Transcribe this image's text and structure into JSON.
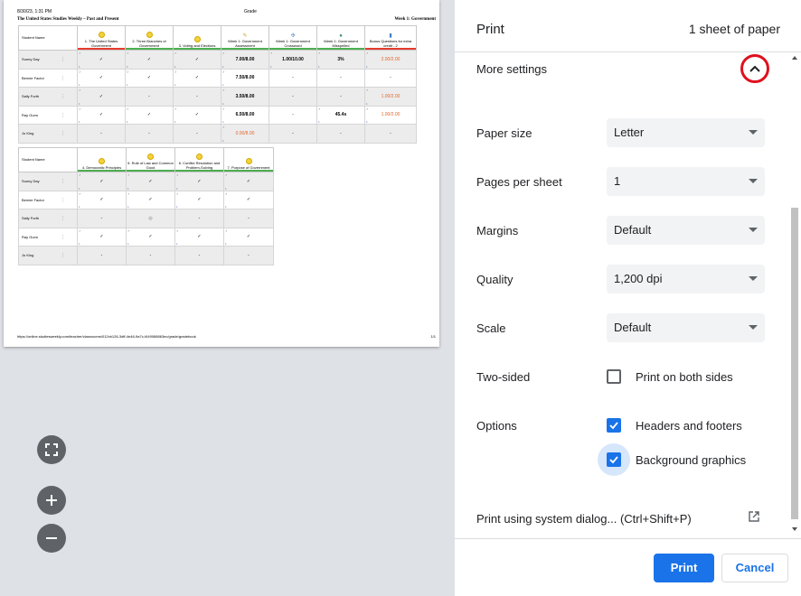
{
  "preview": {
    "header_datetime": "8/30/23, 1:31 PM",
    "header_title": "Grade",
    "course_title": "The United States Studies Weekly – Past and Present",
    "week_title": "Week 1: Government",
    "footer_url": "https://online.studiesweekly.com/teacher/classrooms/012cb126-3dff-4e46-9a7c-f449068863ec/grade/gradebook",
    "footer_page": "1/1",
    "table1": {
      "name_header": "Student Name",
      "columns": [
        "1. The United States Government",
        "2. Three Branches of Government",
        "3. Voting and Elections",
        "Week 1: Government Assessment",
        "Week 1: Government Crossword",
        "Week 1: Government Misspelled",
        "Bonus Questions for extra credit - 2"
      ],
      "rows": [
        {
          "name": "Sunny Day",
          "cells": [
            "✓",
            "✓",
            "✓",
            "7.00/8.00",
            "1.00/10.00",
            "3%",
            "2.00/2.00"
          ]
        },
        {
          "name": "Bennie Factor",
          "cells": [
            "✓",
            "✓",
            "✓",
            "7.50/8.00",
            "-",
            "-",
            "-"
          ]
        },
        {
          "name": "Sally Forth",
          "cells": [
            "✓",
            "-",
            "-",
            "3.50/8.00",
            "-",
            "-",
            "1.00/2.00"
          ]
        },
        {
          "name": "Ray Gunn",
          "cells": [
            "✓",
            "✓",
            "✓",
            "6.50/8.00",
            "-",
            "45.4s",
            "1.00/2.00"
          ]
        },
        {
          "name": "Jo King",
          "cells": [
            "-",
            "-",
            "-",
            "0.00/8.00",
            "-",
            "-",
            "-"
          ]
        }
      ]
    },
    "table2": {
      "name_header": "Student Name",
      "columns": [
        "4. Democratic Principles",
        "5. Rule of Law and Common Good",
        "6. Conflict Resolution and Problem-Solving",
        "7. Purpose of Government"
      ],
      "rows": [
        {
          "name": "Sunny Day",
          "cells": [
            "✓",
            "✓",
            "✓",
            "✓"
          ]
        },
        {
          "name": "Bennie Factor",
          "cells": [
            "✓",
            "✓",
            "✓",
            "✓"
          ]
        },
        {
          "name": "Sally Forth",
          "cells": [
            "-",
            "◎",
            "-",
            "-"
          ]
        },
        {
          "name": "Ray Gunn",
          "cells": [
            "✓",
            "✓",
            "✓",
            "✓"
          ]
        },
        {
          "name": "Jo King",
          "cells": [
            "-",
            "-",
            "-",
            "-"
          ]
        }
      ]
    },
    "zoom_controls": {
      "fit_icon": "fit-to-page-icon",
      "zoom_in_icon": "plus-icon",
      "zoom_out_icon": "minus-icon"
    }
  },
  "panel": {
    "title": "Print",
    "sheet_count": "1 sheet of paper",
    "more_settings_label": "More settings",
    "settings": {
      "paper_size": {
        "label": "Paper size",
        "value": "Letter"
      },
      "pages_per_sheet": {
        "label": "Pages per sheet",
        "value": "1"
      },
      "margins": {
        "label": "Margins",
        "value": "Default"
      },
      "quality": {
        "label": "Quality",
        "value": "1,200 dpi"
      },
      "scale": {
        "label": "Scale",
        "value": "Default"
      }
    },
    "two_sided": {
      "label": "Two-sided",
      "option": "Print on both sides",
      "checked": false
    },
    "options": {
      "label": "Options",
      "headers_footers": {
        "label": "Headers and footers",
        "checked": true
      },
      "background_graphics": {
        "label": "Background graphics",
        "checked": true
      }
    },
    "system_dialog": "Print using system dialog... (Ctrl+Shift+P)",
    "buttons": {
      "print": "Print",
      "cancel": "Cancel"
    }
  },
  "colors": {
    "accent": "#1a73e8",
    "highlight_ring": "#e0101e",
    "score_orange": "#e2682c"
  }
}
